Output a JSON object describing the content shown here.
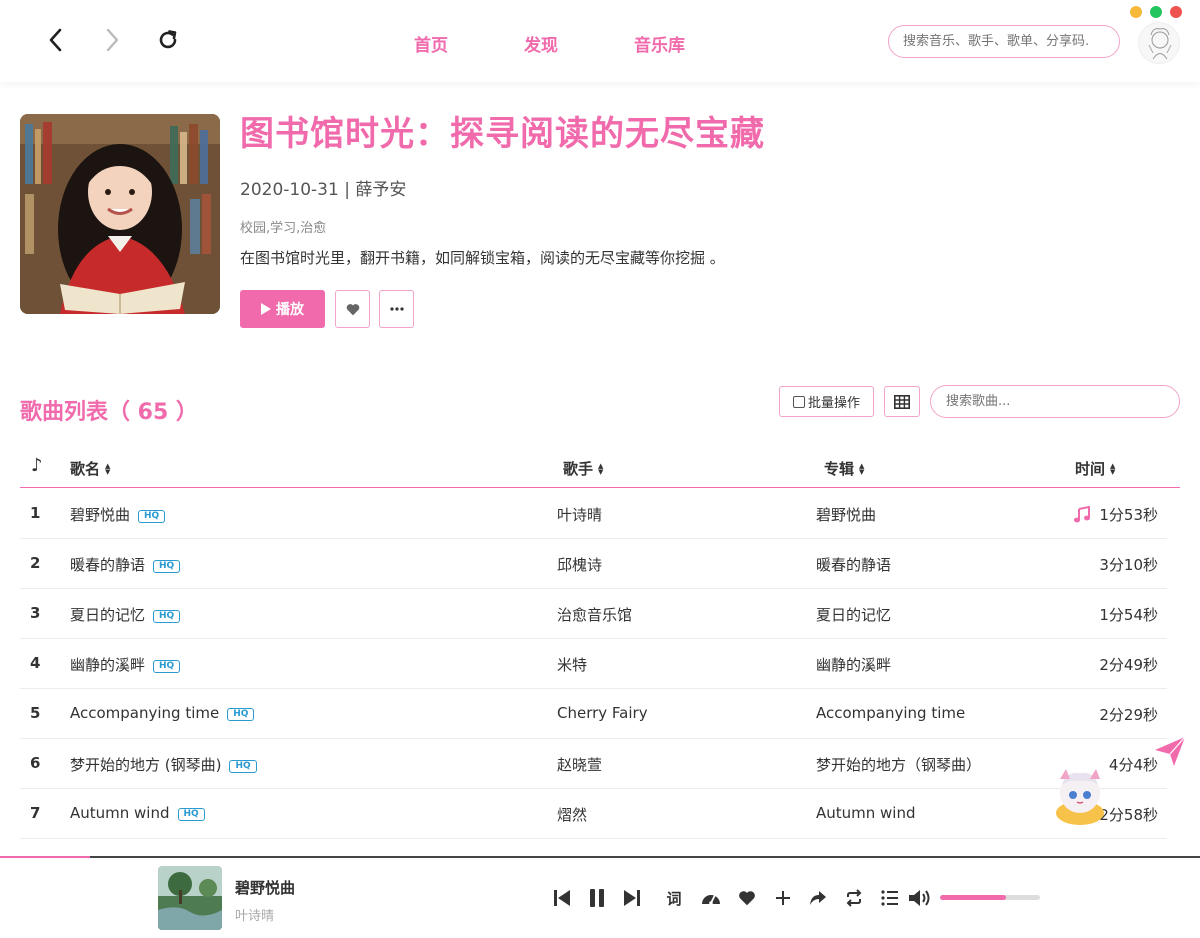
{
  "nav": {
    "tabs": [
      "首页",
      "发现",
      "音乐库"
    ],
    "search_placeholder": "搜索音乐、歌手、歌单、分享码."
  },
  "window_controls": {
    "colors": [
      "#f6b93b",
      "#22c55e",
      "#ef5350"
    ]
  },
  "playlist": {
    "title": "图书馆时光：探寻阅读的无尽宝藏",
    "meta": "2020-10-31 | 薛予安",
    "tags": "校园,学习,治愈",
    "description": "在图书馆时光里，翻开书籍，如同解锁宝箱，阅读的无尽宝藏等你挖掘 。",
    "play_label": "播放"
  },
  "song_list": {
    "title": "歌曲列表（ 65 ）",
    "batch_label": "批量操作",
    "search_placeholder": "搜索歌曲...",
    "headers": {
      "icon": "♪",
      "name": "歌名",
      "singer": "歌手",
      "album": "专辑",
      "time": "时间"
    },
    "hq_label": "HQ",
    "rows": [
      {
        "index": "1",
        "name": "碧野悦曲",
        "singer": "叶诗晴",
        "album": "碧野悦曲",
        "time": "1分53秒",
        "playing": true
      },
      {
        "index": "2",
        "name": "暖春的静语",
        "singer": "邱槐诗",
        "album": "暖春的静语",
        "time": "3分10秒",
        "playing": false
      },
      {
        "index": "3",
        "name": "夏日的记忆",
        "singer": "治愈音乐馆",
        "album": "夏日的记忆",
        "time": "1分54秒",
        "playing": false
      },
      {
        "index": "4",
        "name": "幽静的溪畔",
        "singer": "米特",
        "album": "幽静的溪畔",
        "time": "2分49秒",
        "playing": false
      },
      {
        "index": "5",
        "name": "Accompanying time",
        "singer": "Cherry Fairy",
        "album": "Accompanying time",
        "time": "2分29秒",
        "playing": false
      },
      {
        "index": "6",
        "name": "梦开始的地方 (钢琴曲)",
        "singer": "赵晓萱",
        "album": "梦开始的地方（钢琴曲）",
        "time": "4分4秒",
        "playing": false
      },
      {
        "index": "7",
        "name": "Autumn wind",
        "singer": "熠然",
        "album": "Autumn wind",
        "time": "2分58秒",
        "playing": false
      }
    ]
  },
  "player": {
    "song": "碧野悦曲",
    "artist": "叶诗晴",
    "lyrics_label": "词",
    "volume": 0.66,
    "progress": 0.075
  },
  "accent_color": "#f06aac"
}
